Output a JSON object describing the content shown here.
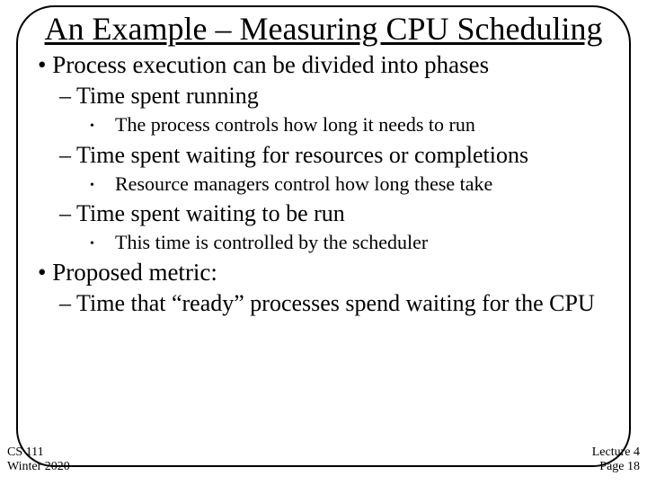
{
  "title": "An Example – Measuring CPU Scheduling",
  "bullets": {
    "l1a": "Process execution can be divided into phases",
    "l2a": "Time spent running",
    "l3a": "The process controls how long it needs to run",
    "l2b": "Time spent waiting for resources or completions",
    "l3b": "Resource managers control how long these take",
    "l2c": "Time spent waiting to be run",
    "l3c": "This time is controlled by the scheduler",
    "l1b": "Proposed metric:",
    "l2d": "Time that “ready” processes spend waiting for the CPU"
  },
  "footer": {
    "course": "CS 111",
    "term": "Winter 2020",
    "lecture": "Lecture 4",
    "page": "Page 18"
  }
}
